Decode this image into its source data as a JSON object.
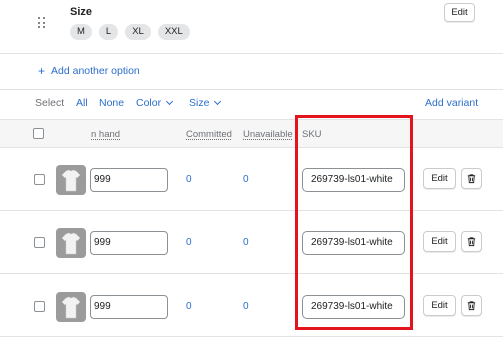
{
  "option": {
    "title": "Size",
    "values": [
      "M",
      "L",
      "XL",
      "XXL"
    ],
    "edit_label": "Edit"
  },
  "add_option": {
    "icon": "plus-icon",
    "label": "Add another option"
  },
  "select_bar": {
    "select_label": "Select",
    "all": "All",
    "none": "None",
    "color": "Color",
    "size": "Size",
    "add_variant": "Add variant"
  },
  "table": {
    "headers": {
      "on_hand": "n hand",
      "committed": "Committed",
      "unavailable": "Unavailable",
      "sku": "SKU"
    },
    "rows": [
      {
        "on_hand": "999",
        "committed": "0",
        "unavailable": "0",
        "sku": "269739-ls01-white",
        "edit_label": "Edit",
        "delete_icon": "trash-icon"
      },
      {
        "on_hand": "999",
        "committed": "0",
        "unavailable": "0",
        "sku": "269739-ls01-white",
        "edit_label": "Edit",
        "delete_icon": "trash-icon"
      },
      {
        "on_hand": "999",
        "committed": "0",
        "unavailable": "0",
        "sku": "269739-ls01-white",
        "edit_label": "Edit",
        "delete_icon": "trash-icon"
      }
    ]
  },
  "colors": {
    "link": "#2c6ecb",
    "annotation": "#e3141b"
  }
}
